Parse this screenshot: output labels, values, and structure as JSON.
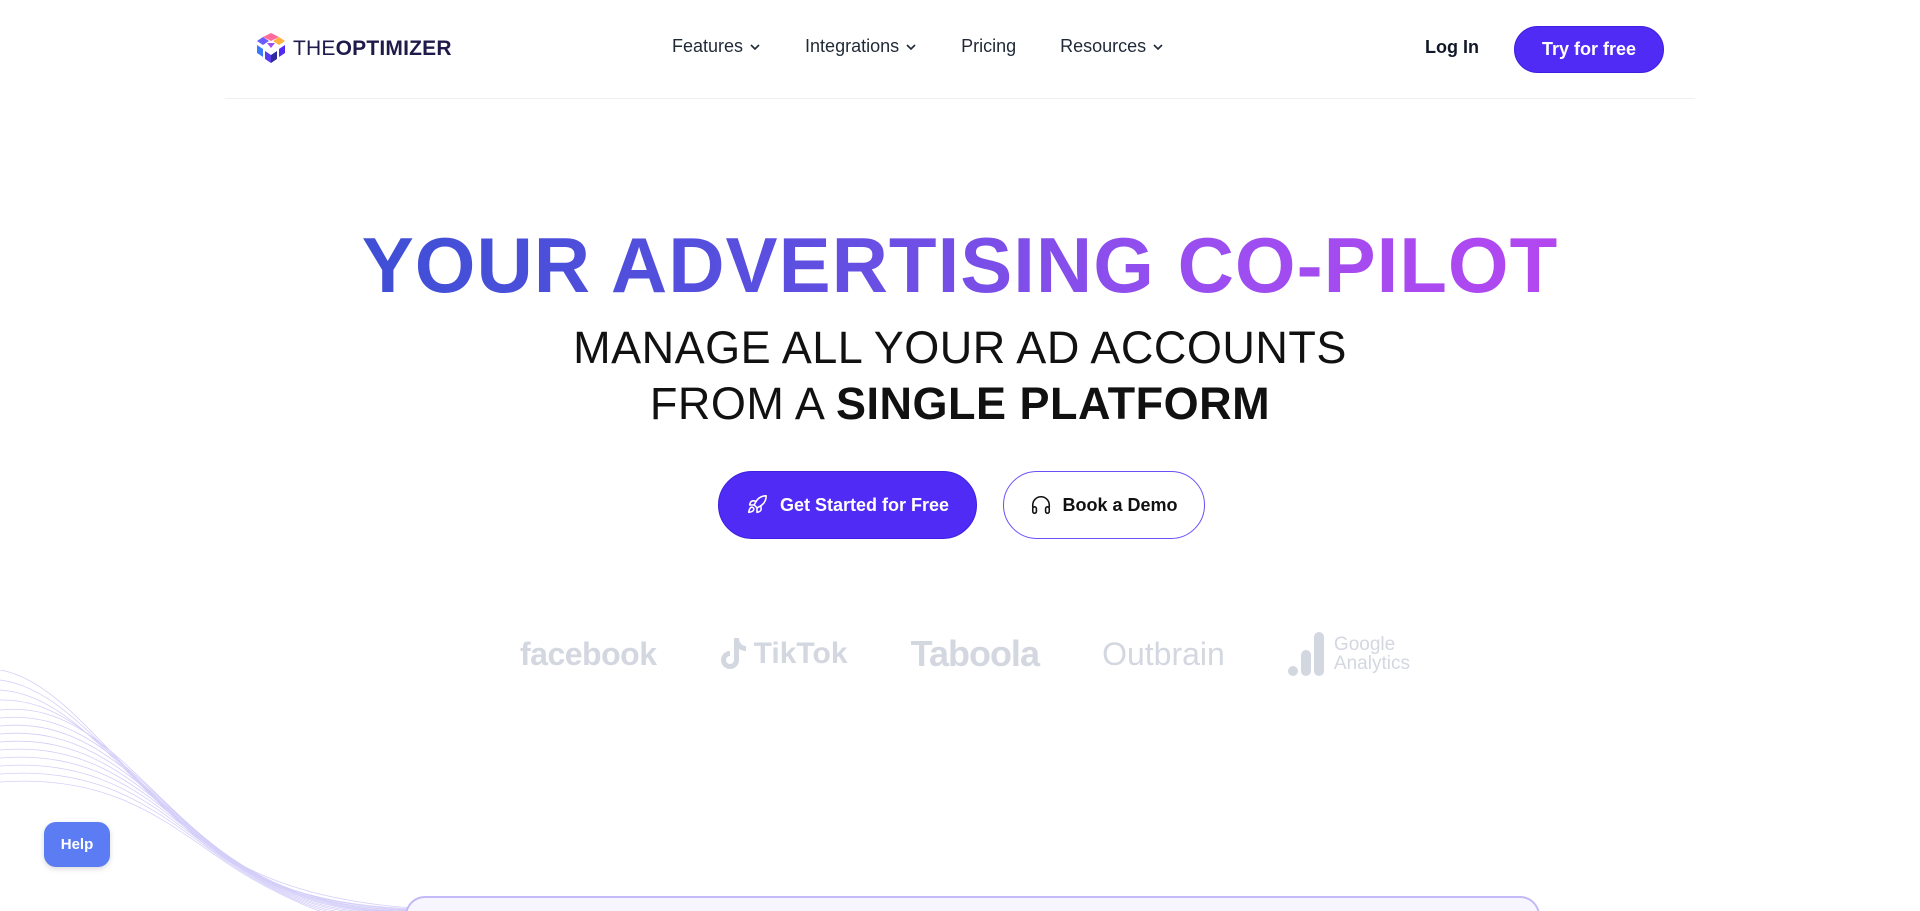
{
  "brand": {
    "logo_light": "THE",
    "logo_bold": "OPTIMIZER"
  },
  "nav": {
    "items": [
      {
        "label": "Features",
        "has_dropdown": true
      },
      {
        "label": "Integrations",
        "has_dropdown": true
      },
      {
        "label": "Pricing",
        "has_dropdown": false
      },
      {
        "label": "Resources",
        "has_dropdown": true
      }
    ],
    "login_label": "Log In",
    "try_label": "Try for free"
  },
  "hero": {
    "title": "YOUR ADVERTISING CO-PILOT",
    "subtitle_line1": "MANAGE ALL YOUR AD ACCOUNTS",
    "subtitle_line2_prefix": "FROM A ",
    "subtitle_line2_strong": "SINGLE PLATFORM",
    "primary_cta": "Get Started for Free",
    "secondary_cta": "Book a Demo"
  },
  "partners": {
    "facebook": "facebook",
    "tiktok": "TikTok",
    "taboola": "Taboola",
    "outbrain": "Outbrain",
    "google_line1": "Google",
    "google_line2": "Analytics"
  },
  "help_label": "Help",
  "colors": {
    "primary": "#4f2bf5",
    "gradient_start": "#3f4fd6",
    "gradient_end": "#b347f0",
    "help": "#5b7cf2",
    "partner_gray": "#d3d7e0"
  }
}
